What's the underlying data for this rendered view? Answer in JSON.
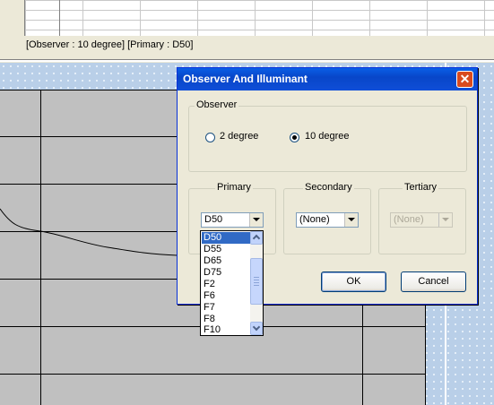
{
  "status_bar": {
    "text": "[Observer : 10 degree]  [Primary : D50]"
  },
  "dialog": {
    "title": "Observer And Illuminant",
    "close_label": "✕",
    "observer": {
      "label": "Observer",
      "options": [
        "2 degree",
        "10 degree"
      ],
      "selected": "10 degree"
    },
    "primary": {
      "label": "Primary",
      "value": "D50"
    },
    "secondary": {
      "label": "Secondary",
      "value": "(None)"
    },
    "tertiary": {
      "label": "Tertiary",
      "value": "(None)",
      "enabled": false
    },
    "ok_label": "OK",
    "cancel_label": "Cancel"
  },
  "primary_dropdown": {
    "items": [
      "D50",
      "D55",
      "D65",
      "D75",
      "F2",
      "F6",
      "F7",
      "F8",
      "F10"
    ],
    "selected": "D50"
  },
  "colors": {
    "title_bar": "#0a5fe6",
    "selection": "#316ac5",
    "close_button": "#d94a1e",
    "workspace": "#b9cfe8",
    "plot_bg": "#c0c0c0"
  }
}
